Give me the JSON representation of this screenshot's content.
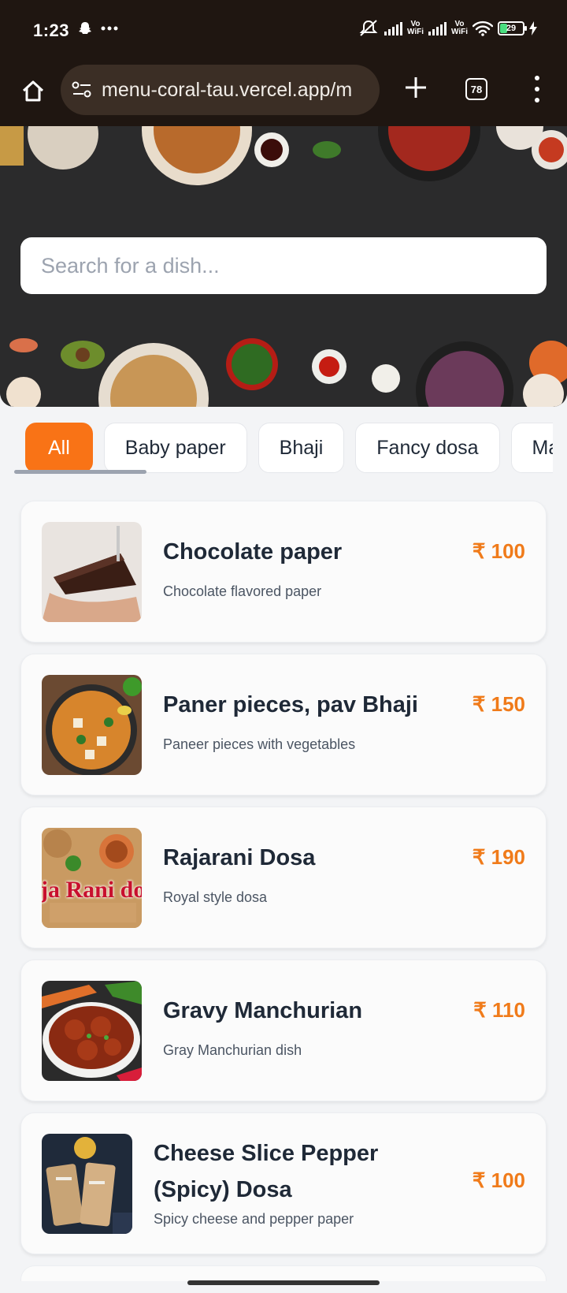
{
  "status_bar": {
    "time": "1:23",
    "battery": "29",
    "vowifi_top": "Vo",
    "vowifi_bottom": "WiFi"
  },
  "browser": {
    "url": "menu-coral-tau.vercel.app/m",
    "tab_count": "78"
  },
  "search": {
    "placeholder": "Search for a dish..."
  },
  "categories": [
    {
      "label": "All",
      "active": true
    },
    {
      "label": "Baby paper"
    },
    {
      "label": "Bhaji"
    },
    {
      "label": "Fancy dosa"
    },
    {
      "label": "Ma"
    }
  ],
  "dishes": [
    {
      "name": "Chocolate paper",
      "description": "Chocolate flavored paper",
      "price": "₹ 100"
    },
    {
      "name": "Paner pieces, pav Bhaji",
      "description": "Paneer pieces with vegetables",
      "price": "₹ 150"
    },
    {
      "name": "Rajarani Dosa",
      "description": "Royal style dosa",
      "price": "₹ 190",
      "image_text": "ja Rani do"
    },
    {
      "name": "Gravy Manchurian",
      "description": "Gray Manchurian dish",
      "price": "₹ 110"
    },
    {
      "name": "Cheese Slice Pepper (Spicy) Dosa",
      "description": "Spicy cheese and pepper paper",
      "price": "₹ 100"
    }
  ],
  "colors": {
    "accent": "#f97316",
    "price": "#f07b1a",
    "chrome": "#1f1611"
  }
}
